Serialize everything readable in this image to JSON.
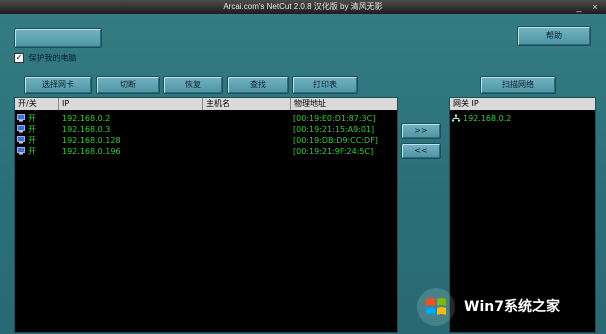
{
  "titlebar": {
    "title": "Arcai.com's NetCut 2.0.8 汉化版 by 清风无影"
  },
  "top_buttons": {
    "help": "帮助"
  },
  "protect_checkbox": {
    "label": "保护我的电脑",
    "checked": true
  },
  "toolbar": {
    "select_nic": "选择网卡",
    "cut": "切断",
    "restore": "恢复",
    "find": "查找",
    "print": "打印表",
    "scan": "扫描网络"
  },
  "hosts_table": {
    "columns": [
      "开/关",
      "IP",
      "主机名",
      "物理地址"
    ],
    "rows": [
      {
        "state": "开",
        "ip": "192.168.0.2",
        "hostname": "",
        "mac": "[00:19:E0:D1:87:3C]"
      },
      {
        "state": "开",
        "ip": "192.168.0.3",
        "hostname": "",
        "mac": "[00:19:21:15:A9:01]"
      },
      {
        "state": "开",
        "ip": "192.168.0.128",
        "hostname": "",
        "mac": "[00:19:DB:D9:CC:DF]"
      },
      {
        "state": "开",
        "ip": "192.168.0.196",
        "hostname": "",
        "mac": "[00:19:21:9F:24:5C]"
      }
    ]
  },
  "transfer": {
    "right": ">>",
    "left": "<<"
  },
  "gateway_table": {
    "header": "网关 IP",
    "rows": [
      {
        "ip": "192.168.0.2"
      }
    ]
  },
  "watermark": {
    "text": "Win7系统之家"
  },
  "colors": {
    "accent": "#2b6f78",
    "list_text": "#2fd02f",
    "panel_bg": "#000000"
  }
}
